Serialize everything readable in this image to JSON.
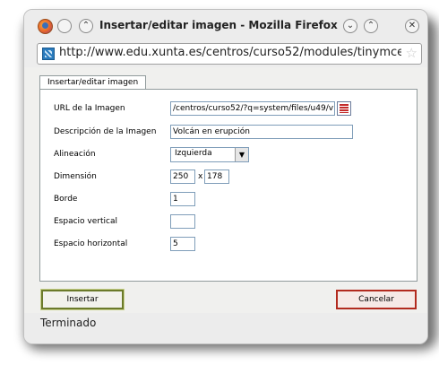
{
  "window": {
    "title": "Insertar/editar imagen - Mozilla Firefox",
    "url": "http://www.edu.xunta.es/centros/curso52/modules/tinymce",
    "status": "Terminado"
  },
  "titlebar_icons": {
    "app": "firefox-logo-icon",
    "menu": "circle-icon",
    "shade": "double-chevron-up-icon",
    "minimize": "chevron-down-icon",
    "maximize": "chevron-up-icon",
    "close": "close-icon"
  },
  "dialog": {
    "tab_label": "Insertar/editar imagen",
    "fields": {
      "url_label": "URL de la Imagen",
      "url_value": "/centros/curso52/?q=system/files/u49/v",
      "description_label": "Descripción de la Imagen",
      "description_value": "Volcán en erupción",
      "align_label": "Alineación",
      "align_value": "Izquierda",
      "dimension_label": "Dimensión",
      "width_value": "250",
      "dimension_separator": "x",
      "height_value": "178",
      "border_label": "Borde",
      "border_value": "1",
      "vspace_label": "Espacio vertical",
      "vspace_value": "",
      "hspace_label": "Espacio horizontal",
      "hspace_value": "5"
    },
    "buttons": {
      "insert_label": "Insertar",
      "cancel_label": "Cancelar"
    }
  },
  "colors": {
    "insert_border": "#6b7a2a",
    "cancel_border": "#b22a1e"
  }
}
